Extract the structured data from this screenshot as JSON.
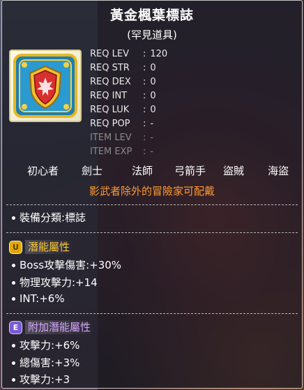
{
  "item": {
    "name": "黃金楓葉標誌",
    "rarity": "(罕見道具)",
    "icon": "golden-maple-leaf-emblem-icon"
  },
  "requirements": [
    {
      "key": "REQ LEV",
      "sep": ":",
      "value": "120",
      "dim": false
    },
    {
      "key": "REQ STR",
      "sep": ":",
      "value": "0",
      "dim": false
    },
    {
      "key": "REQ DEX",
      "sep": ":",
      "value": "0",
      "dim": false
    },
    {
      "key": "REQ INT",
      "sep": ":",
      "value": "0",
      "dim": false
    },
    {
      "key": "REQ LUK",
      "sep": ":",
      "value": "0",
      "dim": false
    },
    {
      "key": "REQ POP",
      "sep": ":",
      "value": "-",
      "dim": false
    },
    {
      "key": "ITEM LEV",
      "sep": ":",
      "value": "-",
      "dim": true
    },
    {
      "key": "ITEM EXP",
      "sep": ":",
      "value": "-",
      "dim": true
    }
  ],
  "jobs": [
    "初心者",
    "劍士",
    "法師",
    "弓箭手",
    "盜賊",
    "海盜"
  ],
  "restriction": "影武者除外的冒險家可配戴",
  "category": "裝備分類:標誌",
  "potential": {
    "badge": "U",
    "label": "潛能屬性",
    "lines": [
      "Boss攻擊傷害:+30%",
      "物理攻擊力:+14",
      "INT:+6%"
    ]
  },
  "additional": {
    "badge": "E",
    "label": "附加潛能屬性",
    "lines": [
      "攻擊力:+6%",
      "總傷害:+3%",
      "攻擊力:+3"
    ]
  },
  "colors": {
    "rarity_border": "#d9c98a",
    "restriction_text": "#ff9933",
    "potential_label": "#ffcc33",
    "additional_label": "#d8a8ff"
  }
}
